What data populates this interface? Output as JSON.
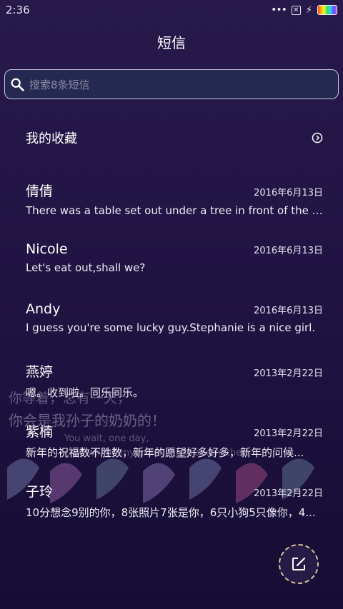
{
  "status_bar": {
    "time": "2:36",
    "icons": [
      "more-dots-icon",
      "sim-x-icon",
      "charging-bolt-icon",
      "battery-icon"
    ]
  },
  "header": {
    "title": "短信"
  },
  "search": {
    "placeholder": "搜索8条短信",
    "icon": "search-icon"
  },
  "favorites": {
    "label": "我的收藏",
    "icon": "chevron-right-icon"
  },
  "conversations": [
    {
      "name": "倩倩",
      "date": "2016年6月13日",
      "preview": "There was a table set out under a tree in front of the ho..."
    },
    {
      "name": "Nicole",
      "date": "2016年6月13日",
      "preview": "Let's eat out,shall we?"
    },
    {
      "name": "Andy",
      "date": "2016年6月13日",
      "preview": "I guess you're some lucky guy.Stephanie is a nice girl."
    },
    {
      "name": "燕婷",
      "date": "2013年2月22日",
      "preview": "嗯。收到啦。同乐同乐。"
    },
    {
      "name": "紫楠",
      "date": "2013年2月22日",
      "preview": "新年的祝福数不胜数，新年的愿望好多好多，新年的问候..."
    },
    {
      "name": "子玲",
      "date": "2013年2月22日",
      "preview": "10分想念9别的你，8张照片7张是你，6只小狗5只像你，4..."
    }
  ],
  "compose": {
    "icon": "compose-icon"
  },
  "wallpaper": {
    "line1": "你等着，总有一天，",
    "line2": "你会是我孙子的奶奶的！",
    "line3": "You wait, one day,",
    "line4": "You will be my grandson grandmother!"
  }
}
